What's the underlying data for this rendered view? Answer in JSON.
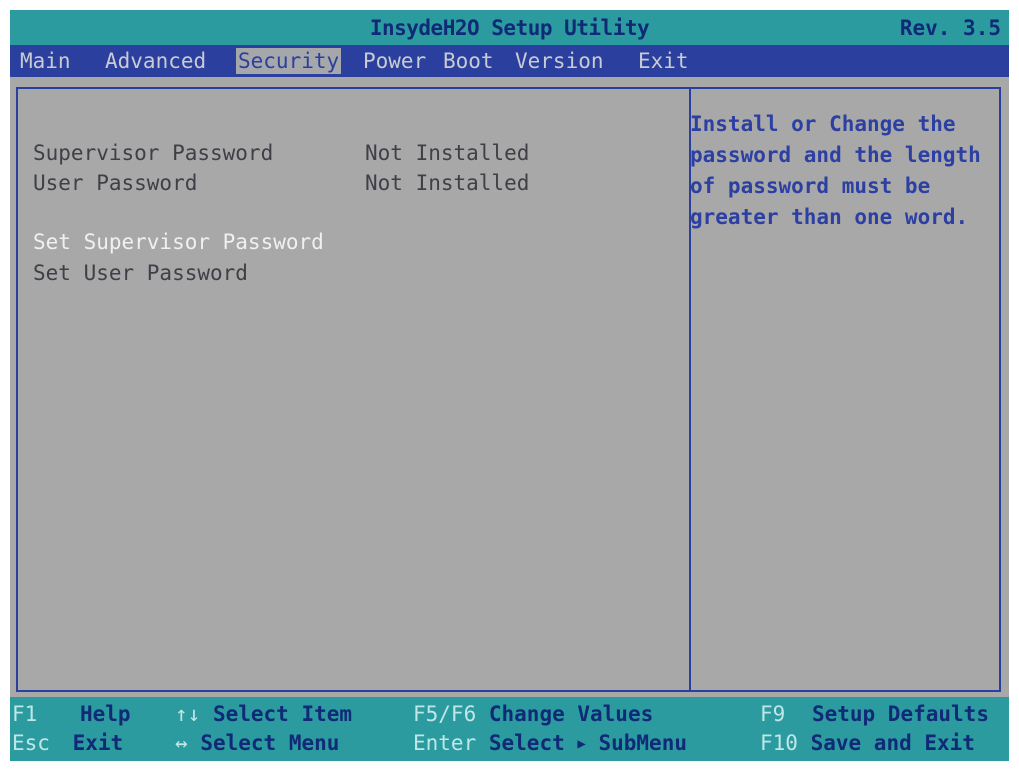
{
  "header": {
    "title": "InsydeH2O Setup Utility",
    "revision": "Rev. 3.5"
  },
  "menu": {
    "tabs": [
      {
        "label": "Main"
      },
      {
        "label": "Advanced"
      },
      {
        "label": "Security"
      },
      {
        "label": "Power"
      },
      {
        "label": "Boot"
      },
      {
        "label": "Version"
      },
      {
        "label": "Exit"
      }
    ],
    "active": "Security"
  },
  "settings": {
    "supervisor_password_label": "Supervisor Password",
    "supervisor_password_value": "Not Installed",
    "user_password_label": "User Password",
    "user_password_value": "Not Installed",
    "set_supervisor_password": "Set Supervisor Password",
    "set_user_password": "Set User Password"
  },
  "help": {
    "lines": [
      "Install or Change the",
      "password and the length",
      "of password  must be",
      "greater than one word."
    ]
  },
  "keys": [
    {
      "key": "F1",
      "desc": "Help"
    },
    {
      "key": "↑↓",
      "desc": "Select Item"
    },
    {
      "key": "F5/F6",
      "desc": "Change Values"
    },
    {
      "key": "F9",
      "desc": "Setup Defaults"
    },
    {
      "key": "Esc",
      "desc": "Exit"
    },
    {
      "key": "↔",
      "desc": "Select Menu"
    },
    {
      "key": "Enter",
      "desc": "Select",
      "desc2": "SubMenu"
    },
    {
      "key": "F10",
      "desc": "Save and Exit"
    }
  ],
  "colors": {
    "title_bar": "#2c9b9f",
    "menu_bar": "#2a3f9e",
    "panel": "#a8a8a8",
    "help_text": "#2c3fa2",
    "selected_text": "#f0f0f0"
  }
}
